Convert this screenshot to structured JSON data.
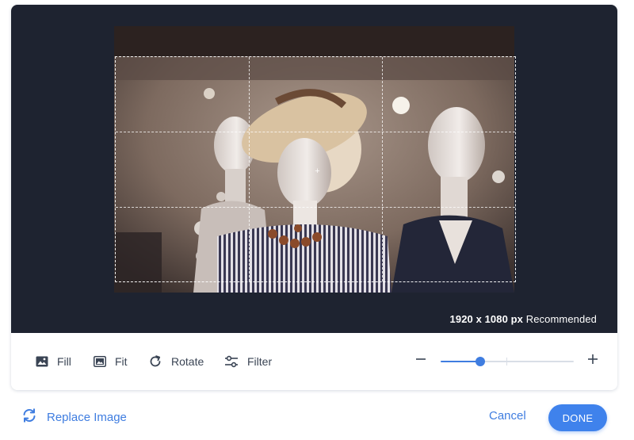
{
  "editor": {
    "image_icon": "mannequins-photo",
    "resolution_value": "1920 x 1080 px",
    "resolution_note": "Recommended"
  },
  "toolbar": {
    "fill_label": "Fill",
    "fit_label": "Fit",
    "rotate_label": "Rotate",
    "filter_label": "Filter",
    "zoom_level": 0.3
  },
  "footer": {
    "replace_label": "Replace Image",
    "cancel_label": "Cancel",
    "done_label": "DONE"
  },
  "colors": {
    "accent": "#3f7de0",
    "stage_background": "#1e2330"
  }
}
